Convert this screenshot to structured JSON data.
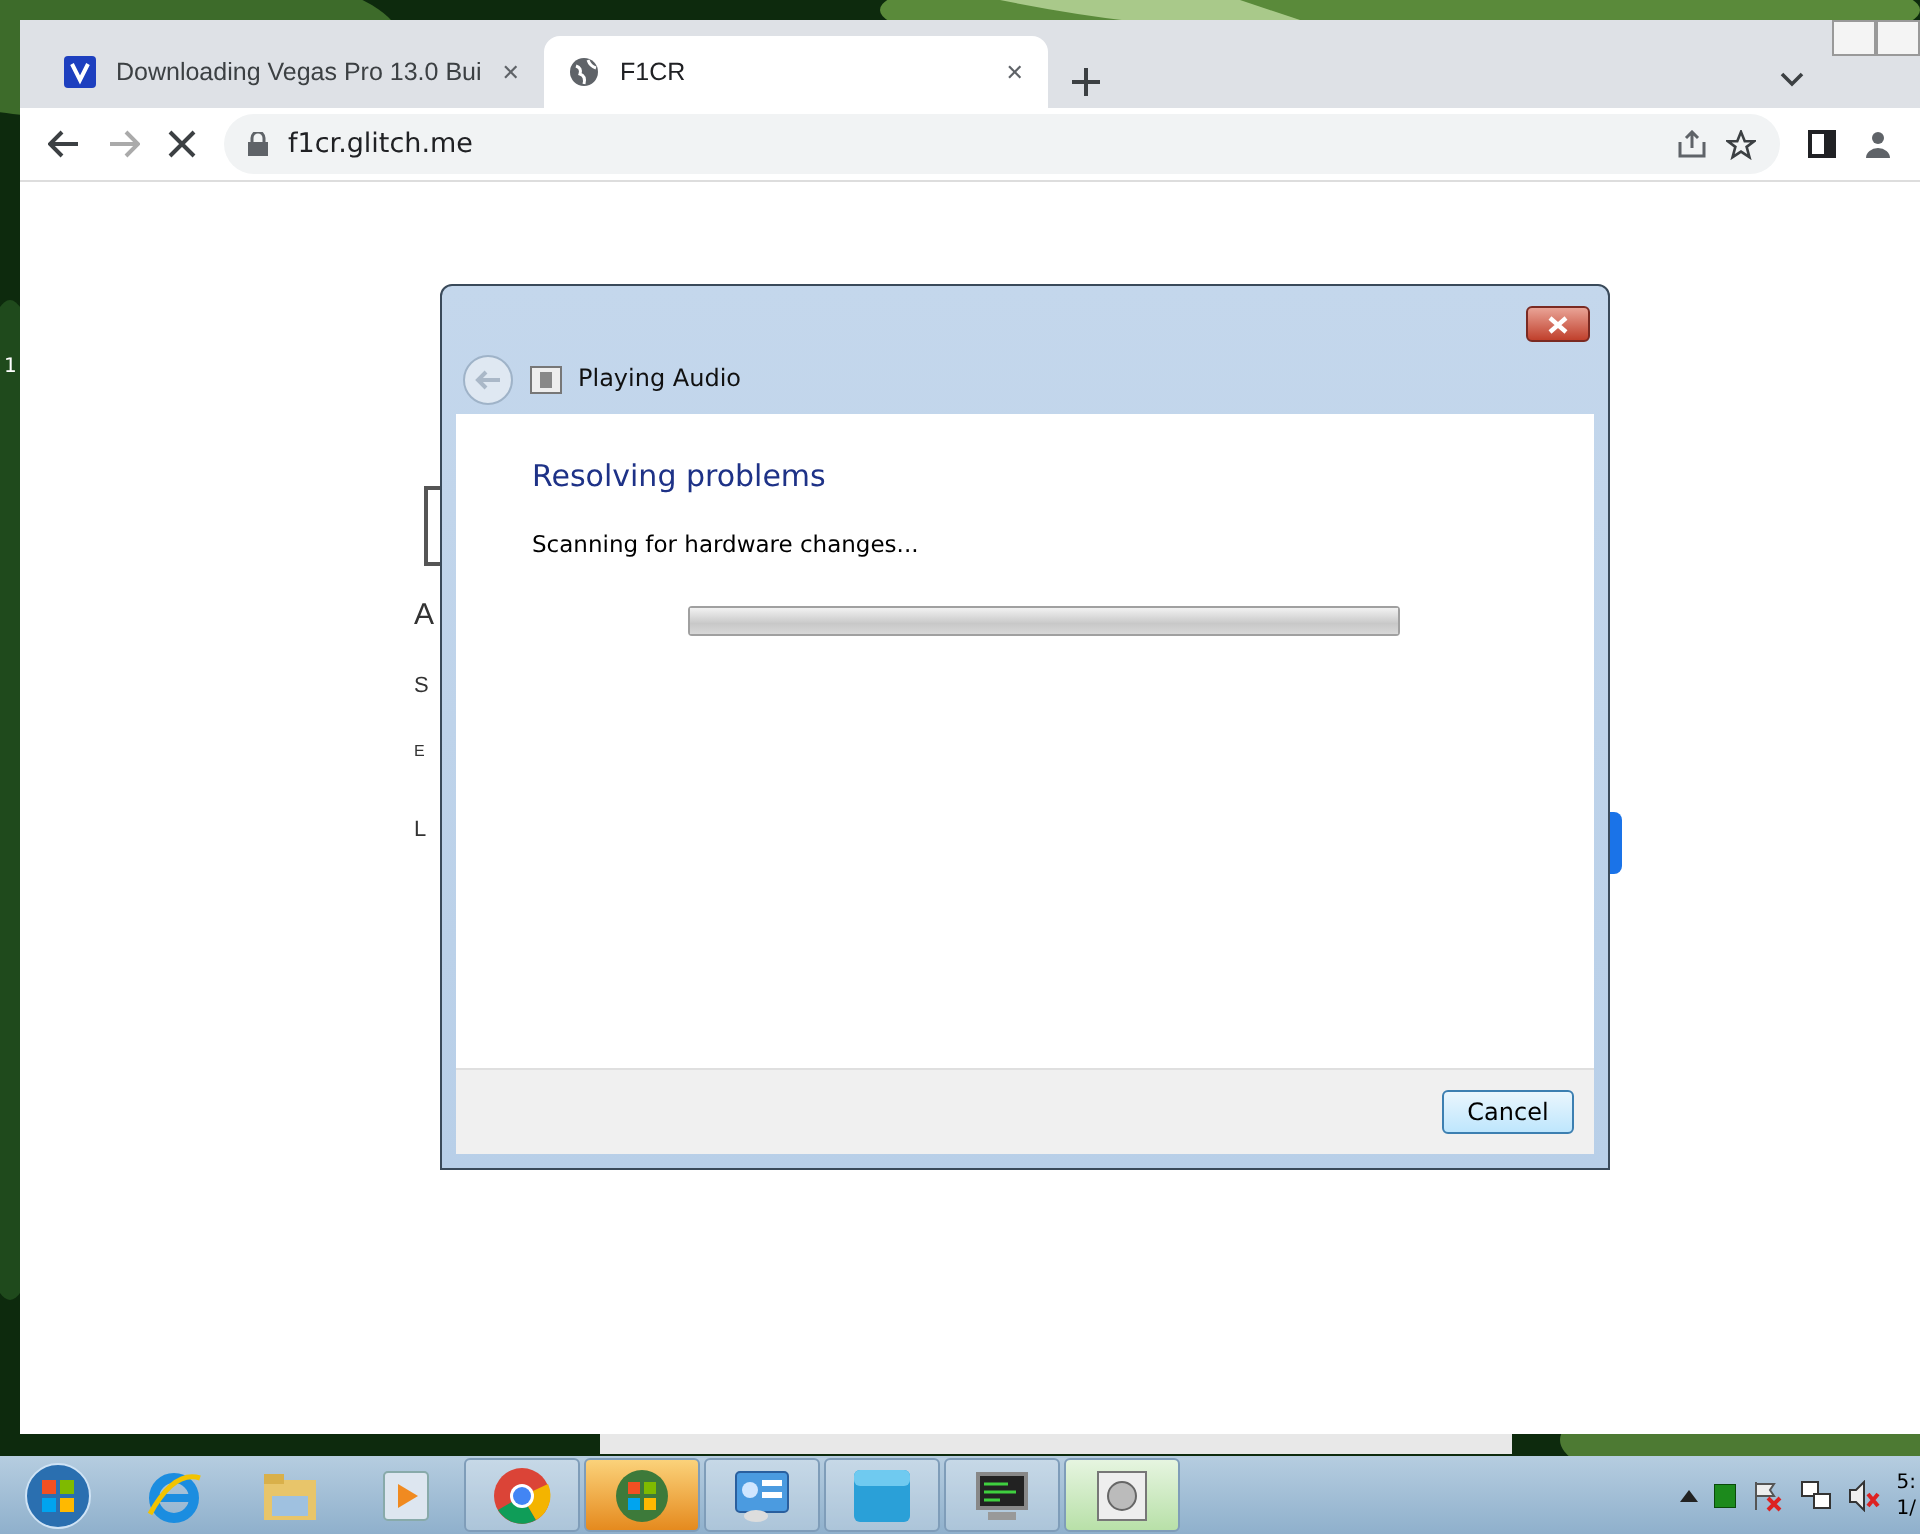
{
  "desktop": {
    "icon_label": "1"
  },
  "browser": {
    "tabs": [
      {
        "title": "Downloading Vegas Pro 13.0 Bui",
        "close": "✕",
        "selected": false
      },
      {
        "title": "F1CR",
        "close": "✕",
        "selected": true
      }
    ],
    "address": "f1cr.glitch.me",
    "page_fragments": [
      "A",
      "S",
      "E",
      "L"
    ]
  },
  "dialog": {
    "title": "Playing Audio",
    "heading": "Resolving problems",
    "status": "Scanning for hardware changes...",
    "progress": {
      "level": 1
    },
    "buttons": [
      "Cancel"
    ]
  },
  "taskbar": {
    "clock": {
      "time": "5:",
      "date": "1/"
    }
  }
}
